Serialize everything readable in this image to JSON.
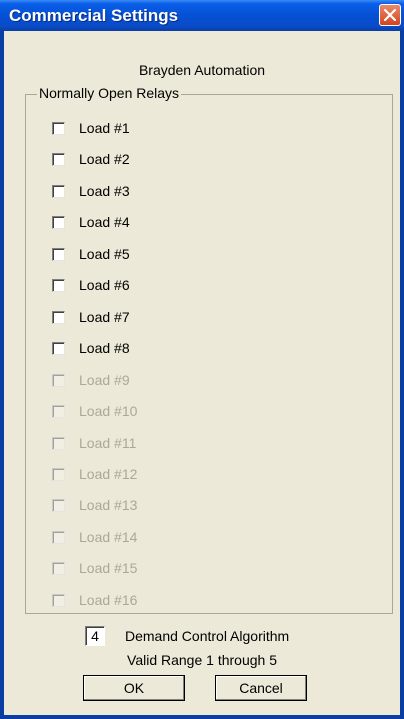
{
  "window": {
    "title": "Commercial Settings",
    "company": "Brayden Automation"
  },
  "relays": {
    "group_label": "Normally Open Relays",
    "loads": [
      {
        "label": "Load #1",
        "enabled": true,
        "checked": false
      },
      {
        "label": "Load #2",
        "enabled": true,
        "checked": false
      },
      {
        "label": "Load #3",
        "enabled": true,
        "checked": false
      },
      {
        "label": "Load #4",
        "enabled": true,
        "checked": false
      },
      {
        "label": "Load #5",
        "enabled": true,
        "checked": false
      },
      {
        "label": "Load #6",
        "enabled": true,
        "checked": false
      },
      {
        "label": "Load #7",
        "enabled": true,
        "checked": false
      },
      {
        "label": "Load #8",
        "enabled": true,
        "checked": false
      },
      {
        "label": "Load #9",
        "enabled": false,
        "checked": false
      },
      {
        "label": "Load #10",
        "enabled": false,
        "checked": false
      },
      {
        "label": "Load #11",
        "enabled": false,
        "checked": false
      },
      {
        "label": "Load #12",
        "enabled": false,
        "checked": false
      },
      {
        "label": "Load #13",
        "enabled": false,
        "checked": false
      },
      {
        "label": "Load #14",
        "enabled": false,
        "checked": false
      },
      {
        "label": "Load #15",
        "enabled": false,
        "checked": false
      },
      {
        "label": "Load #16",
        "enabled": false,
        "checked": false
      }
    ]
  },
  "algorithm": {
    "value": "4",
    "label": "Demand Control Algorithm",
    "range_text": "Valid Range 1 through 5"
  },
  "buttons": {
    "ok": "OK",
    "cancel": "Cancel"
  }
}
